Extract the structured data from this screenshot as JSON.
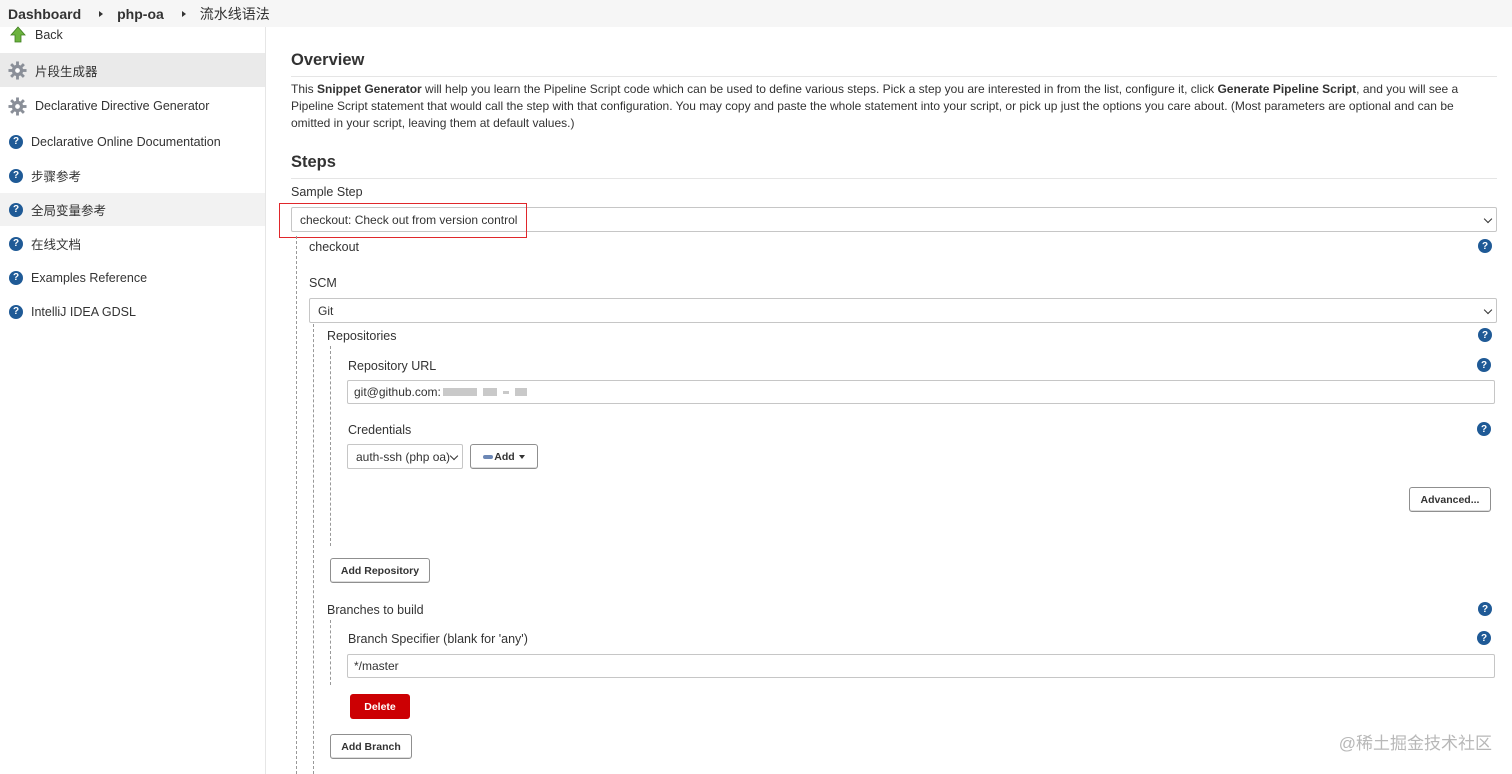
{
  "breadcrumb": {
    "items": [
      "Dashboard",
      "php-oa",
      "流水线语法"
    ]
  },
  "sidebar": {
    "back_label": "Back",
    "items": [
      {
        "label": "片段生成器",
        "icon": "gear-icon"
      },
      {
        "label": "Declarative Directive Generator",
        "icon": "gear-icon"
      },
      {
        "label": "Declarative Online Documentation",
        "icon": "help-icon"
      },
      {
        "label": "步骤参考",
        "icon": "help-icon"
      },
      {
        "label": "全局变量参考",
        "icon": "help-icon"
      },
      {
        "label": "在线文档",
        "icon": "help-icon"
      },
      {
        "label": "Examples Reference",
        "icon": "help-icon"
      },
      {
        "label": "IntelliJ IDEA GDSL",
        "icon": "help-icon"
      }
    ]
  },
  "overview": {
    "title": "Overview",
    "text_1": "This ",
    "bold_1": "Snippet Generator",
    "text_2": " will help you learn the Pipeline Script code which can be used to define various steps. Pick a step you are interested in from the list, configure it, click ",
    "bold_2": "Generate Pipeline Script",
    "text_3": ", and you will see a Pipeline Script statement that would call the step with that configuration. You may copy and paste the whole statement into your script, or pick up just the options you care about. (Most parameters are optional and can be omitted in your script, leaving them at default values.)"
  },
  "steps": {
    "title": "Steps",
    "sample_step_label": "Sample Step",
    "sample_step_value": "checkout: Check out from version control",
    "checkout_label": "checkout",
    "scm_label": "SCM",
    "scm_value": "Git",
    "repositories_label": "Repositories",
    "repo_url_label": "Repository URL",
    "repo_url_value": "git@github.com:",
    "credentials_label": "Credentials",
    "credentials_value": "auth-ssh (php oa)",
    "add_label": "Add",
    "advanced_label": "Advanced...",
    "add_repository_label": "Add Repository",
    "branches_label": "Branches to build",
    "branch_spec_label": "Branch Specifier (blank for 'any')",
    "branch_spec_value": "*/master",
    "delete_label": "Delete",
    "add_branch_label": "Add Branch"
  },
  "colors": {
    "help": "#1f5a96",
    "delete": "#cc0003",
    "highlight": "#e0272b"
  },
  "watermark": "@稀土掘金技术社区"
}
